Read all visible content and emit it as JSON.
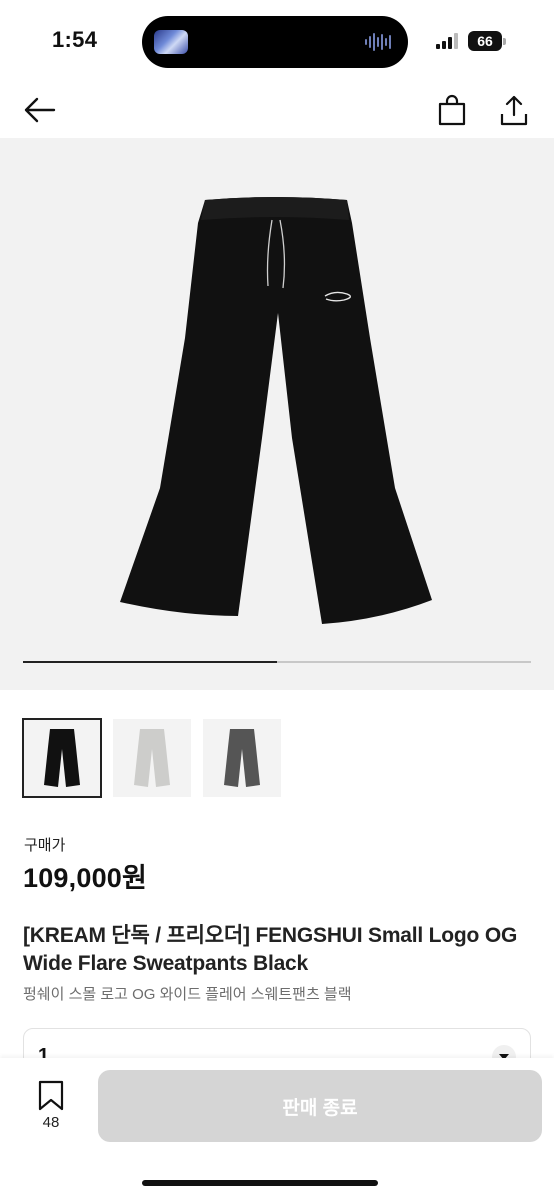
{
  "status": {
    "time": "1:54",
    "battery": "66"
  },
  "nav": {
    "back_icon": "arrow-left-icon",
    "bag_icon": "shopping-bag-icon",
    "share_icon": "share-icon"
  },
  "gallery": {
    "progress": 0.5,
    "thumbnails": [
      {
        "color": "black",
        "selected": true
      },
      {
        "color": "light-gray",
        "selected": false
      },
      {
        "color": "charcoal",
        "selected": false
      }
    ]
  },
  "product": {
    "price_label": "구매가",
    "price": "109,000원",
    "title": "[KREAM 단독 / 프리오더] FENGSHUI Small Logo OG Wide Flare Sweatpants Black",
    "subtitle": "펑쉐이 스몰 로고 OG 와이드 플레어 스웨트팬츠 블랙",
    "size_value": "1"
  },
  "bottom": {
    "wish_count": "48",
    "cta_label": "판매 종료"
  },
  "colors": {
    "cta_disabled": "#d5d5d5",
    "text_primary": "#222222",
    "text_secondary": "#6d6d6d"
  }
}
